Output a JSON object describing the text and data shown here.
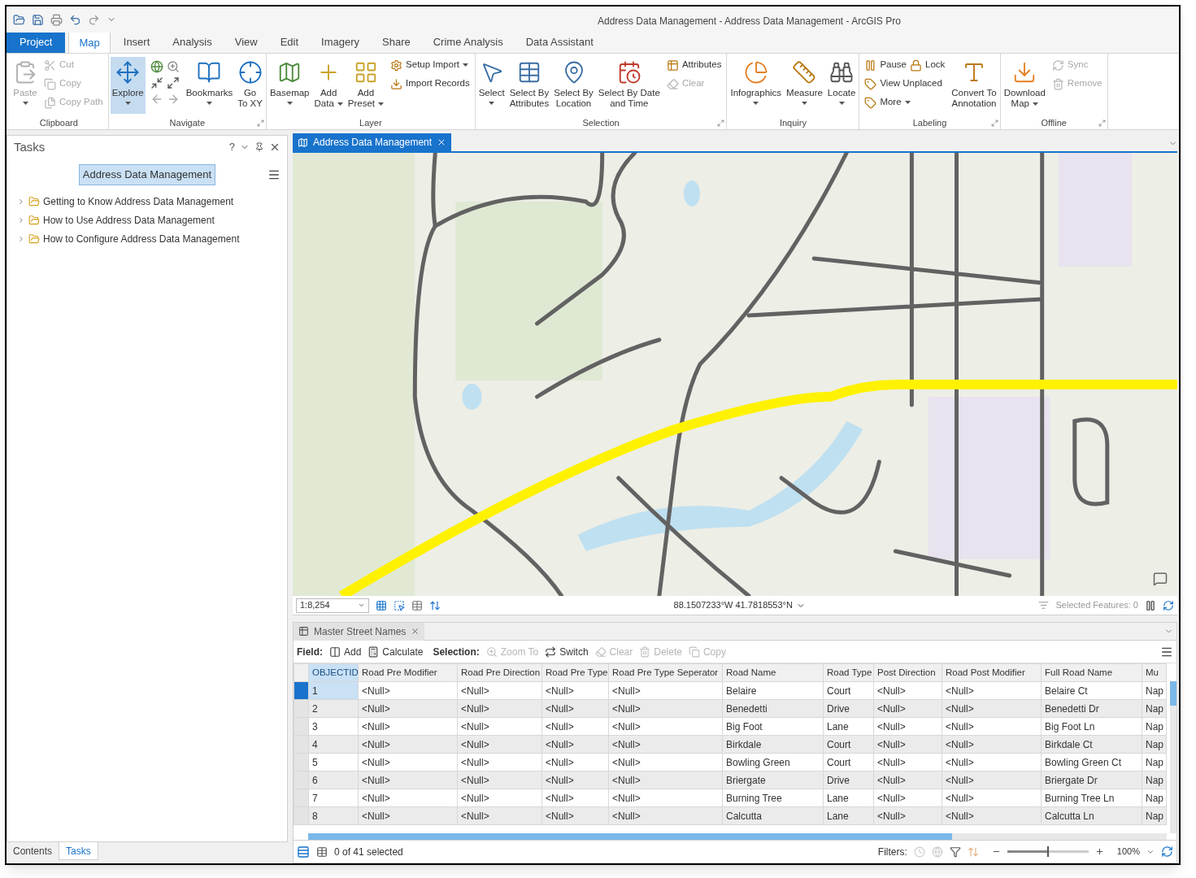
{
  "window": {
    "title": "Address Data Management - Address Data Management - ArcGIS Pro"
  },
  "ribbon_tabs": [
    {
      "label": "Project",
      "kind": "backstage",
      "selected": false
    },
    {
      "label": "Map",
      "kind": "tab",
      "selected": true
    },
    {
      "label": "Insert",
      "kind": "tab",
      "selected": false
    },
    {
      "label": "Analysis",
      "kind": "tab",
      "selected": false
    },
    {
      "label": "View",
      "kind": "tab",
      "selected": false
    },
    {
      "label": "Edit",
      "kind": "tab",
      "selected": false
    },
    {
      "label": "Imagery",
      "kind": "tab",
      "selected": false
    },
    {
      "label": "Share",
      "kind": "tab",
      "selected": false
    },
    {
      "label": "Crime Analysis",
      "kind": "tab",
      "selected": false
    },
    {
      "label": "Data Assistant",
      "kind": "tab",
      "selected": false
    }
  ],
  "ribbon_groups": [
    {
      "label": "Clipboard",
      "launcher": false,
      "items": [
        {
          "kind": "large",
          "label": "Paste",
          "disabled": true,
          "selected": false,
          "dropdown": true
        },
        {
          "kind": "stack",
          "rows": [
            [
              {
                "label": "Cut",
                "disabled": true,
                "dropdown": false
              }
            ],
            [
              {
                "label": "Copy",
                "disabled": true,
                "dropdown": false
              }
            ],
            [
              {
                "label": "Copy Path",
                "disabled": true,
                "dropdown": false
              }
            ]
          ]
        }
      ]
    },
    {
      "label": "Navigate",
      "launcher": true,
      "items": [
        {
          "kind": "large",
          "label": "Explore",
          "disabled": false,
          "selected": true,
          "dropdown": true
        },
        {
          "kind": "tools"
        },
        {
          "kind": "large",
          "label": "Bookmarks",
          "disabled": false,
          "selected": false,
          "dropdown": true
        },
        {
          "kind": "large",
          "label": "Go\nTo XY",
          "disabled": false,
          "selected": false,
          "dropdown": false
        }
      ]
    },
    {
      "label": "Layer",
      "launcher": false,
      "items": [
        {
          "kind": "large",
          "label": "Basemap",
          "disabled": false,
          "selected": false,
          "dropdown": true
        },
        {
          "kind": "large",
          "label": "Add\nData",
          "disabled": false,
          "selected": false,
          "dropdown": true
        },
        {
          "kind": "large",
          "label": "Add\nPreset",
          "disabled": false,
          "selected": false,
          "dropdown": true
        },
        {
          "kind": "stack",
          "rows": [
            [
              {
                "label": "Setup Import",
                "disabled": false,
                "dropdown": true
              }
            ],
            [
              {
                "label": "Import Records",
                "disabled": false,
                "dropdown": false
              }
            ]
          ]
        }
      ]
    },
    {
      "label": "Selection",
      "launcher": true,
      "items": [
        {
          "kind": "large",
          "label": "Select",
          "disabled": false,
          "selected": false,
          "dropdown": true
        },
        {
          "kind": "large",
          "label": "Select By\nAttributes",
          "disabled": false,
          "selected": false,
          "dropdown": false
        },
        {
          "kind": "large",
          "label": "Select By\nLocation",
          "disabled": false,
          "selected": false,
          "dropdown": false
        },
        {
          "kind": "large",
          "label": "Select By Date\nand Time",
          "disabled": false,
          "selected": false,
          "dropdown": false
        },
        {
          "kind": "stack",
          "rows": [
            [
              {
                "label": "Attributes",
                "disabled": false,
                "dropdown": false
              }
            ],
            [
              {
                "label": "Clear",
                "disabled": true,
                "dropdown": false
              }
            ]
          ]
        }
      ]
    },
    {
      "label": "Inquiry",
      "launcher": false,
      "items": [
        {
          "kind": "large",
          "label": "Infographics",
          "disabled": false,
          "selected": false,
          "dropdown": true
        },
        {
          "kind": "large",
          "label": "Measure",
          "disabled": false,
          "selected": false,
          "dropdown": true
        },
        {
          "kind": "large",
          "label": "Locate",
          "disabled": false,
          "selected": false,
          "dropdown": true
        }
      ]
    },
    {
      "label": "Labeling",
      "launcher": true,
      "items": [
        {
          "kind": "stack",
          "rows": [
            [
              {
                "label": "Pause",
                "disabled": false,
                "dropdown": false
              },
              {
                "label": "Lock",
                "disabled": false,
                "dropdown": false
              }
            ],
            [
              {
                "label": "View Unplaced",
                "disabled": false,
                "dropdown": false
              }
            ],
            [
              {
                "label": "More",
                "disabled": false,
                "dropdown": true
              }
            ]
          ]
        },
        {
          "kind": "large",
          "label": "Convert To\nAnnotation",
          "disabled": false,
          "selected": false,
          "dropdown": false
        }
      ]
    },
    {
      "label": "Offline",
      "launcher": true,
      "items": [
        {
          "kind": "large",
          "label": "Download\nMap",
          "disabled": false,
          "selected": false,
          "dropdown": true
        },
        {
          "kind": "stack",
          "rows": [
            [
              {
                "label": "Sync",
                "disabled": true,
                "dropdown": false
              }
            ],
            [
              {
                "label": "Remove",
                "disabled": true,
                "dropdown": false
              }
            ]
          ]
        }
      ]
    }
  ],
  "tasks_pane": {
    "title": "Tasks",
    "help": "?",
    "task_button": {
      "label": "Address Data Management",
      "selected": true
    },
    "tasks": [
      {
        "label": "Getting to Know Address Data Management",
        "expanded": false
      },
      {
        "label": "How to Use Address Data Management",
        "expanded": false
      },
      {
        "label": "How to Configure Address Data Management",
        "expanded": false
      }
    ]
  },
  "pane_tabs": [
    {
      "label": "Contents",
      "selected": false
    },
    {
      "label": "Tasks",
      "selected": true
    }
  ],
  "map_view": {
    "tab": {
      "label": "Address Data Management",
      "selected": true
    },
    "scale": "1:8,254",
    "coordinates": "88.1507233°W 41.7818553°N",
    "selected_features": "Selected Features: 0"
  },
  "table_view": {
    "tab": {
      "label": "Master Street Names",
      "selected": true
    },
    "toolbar": [
      {
        "kind": "label",
        "label": "Field:"
      },
      {
        "kind": "button",
        "label": "Add",
        "disabled": false
      },
      {
        "kind": "button",
        "label": "Calculate",
        "disabled": false
      },
      {
        "kind": "label",
        "label": "Selection:"
      },
      {
        "kind": "button",
        "label": "Zoom To",
        "disabled": true
      },
      {
        "kind": "button",
        "label": "Switch",
        "disabled": false
      },
      {
        "kind": "button",
        "label": "Clear",
        "disabled": true
      },
      {
        "kind": "button",
        "label": "Delete",
        "disabled": true
      },
      {
        "kind": "button",
        "label": "Copy",
        "disabled": true
      }
    ],
    "columns": [
      {
        "label": "OBJECTID",
        "selected": true
      },
      {
        "label": "Road Pre Modifier",
        "selected": false
      },
      {
        "label": "Road Pre Direction",
        "selected": false
      },
      {
        "label": "Road Pre Type",
        "selected": false
      },
      {
        "label": "Road Pre Type Seperator",
        "selected": false
      },
      {
        "label": "Road Name",
        "selected": false
      },
      {
        "label": "Road Type",
        "selected": false
      },
      {
        "label": "Post Direction",
        "selected": false
      },
      {
        "label": "Road Post Modifier",
        "selected": false
      },
      {
        "label": "Full Road Name",
        "selected": false
      },
      {
        "label": "Mu",
        "selected": false
      }
    ],
    "rows": [
      {
        "selected": true,
        "cells": [
          "1",
          "<Null>",
          "<Null>",
          "<Null>",
          "<Null>",
          "Belaire",
          "Court",
          "<Null>",
          "<Null>",
          "Belaire Ct",
          "Nap"
        ]
      },
      {
        "selected": false,
        "cells": [
          "2",
          "<Null>",
          "<Null>",
          "<Null>",
          "<Null>",
          "Benedetti",
          "Drive",
          "<Null>",
          "<Null>",
          "Benedetti Dr",
          "Nap"
        ]
      },
      {
        "selected": false,
        "cells": [
          "3",
          "<Null>",
          "<Null>",
          "<Null>",
          "<Null>",
          "Big Foot",
          "Lane",
          "<Null>",
          "<Null>",
          "Big Foot Ln",
          "Nap"
        ]
      },
      {
        "selected": false,
        "cells": [
          "4",
          "<Null>",
          "<Null>",
          "<Null>",
          "<Null>",
          "Birkdale",
          "Court",
          "<Null>",
          "<Null>",
          "Birkdale Ct",
          "Nap"
        ]
      },
      {
        "selected": false,
        "cells": [
          "5",
          "<Null>",
          "<Null>",
          "<Null>",
          "<Null>",
          "Bowling Green",
          "Court",
          "<Null>",
          "<Null>",
          "Bowling Green Ct",
          "Nap"
        ]
      },
      {
        "selected": false,
        "cells": [
          "6",
          "<Null>",
          "<Null>",
          "<Null>",
          "<Null>",
          "Briergate",
          "Drive",
          "<Null>",
          "<Null>",
          "Briergate Dr",
          "Nap"
        ]
      },
      {
        "selected": false,
        "cells": [
          "7",
          "<Null>",
          "<Null>",
          "<Null>",
          "<Null>",
          "Burning Tree",
          "Lane",
          "<Null>",
          "<Null>",
          "Burning Tree Ln",
          "Nap"
        ]
      },
      {
        "selected": false,
        "cells": [
          "8",
          "<Null>",
          "<Null>",
          "<Null>",
          "<Null>",
          "Calcutta",
          "Lane",
          "<Null>",
          "<Null>",
          "Calcutta Ln",
          "Nap"
        ]
      }
    ],
    "status": "0 of 41 selected",
    "filters_label": "Filters:",
    "zoom": {
      "level": 0.5,
      "reading": "100%"
    }
  }
}
